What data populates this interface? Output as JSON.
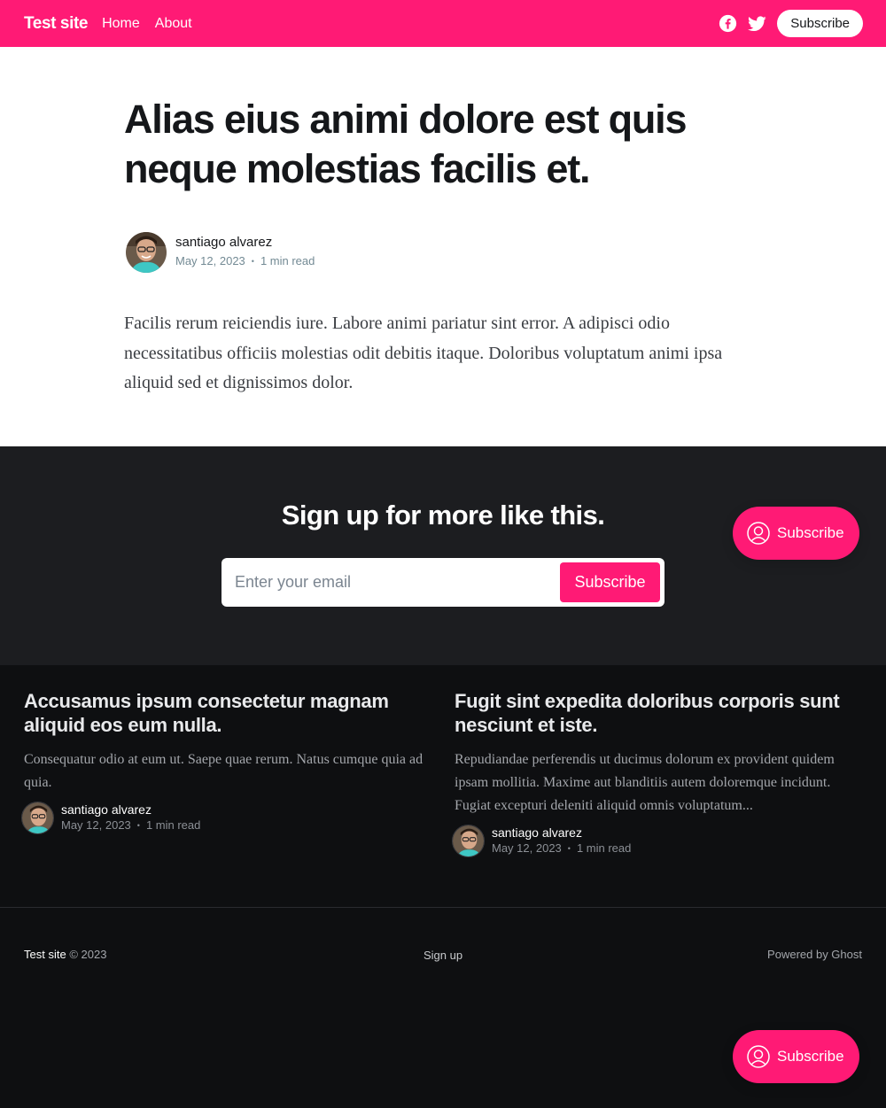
{
  "header": {
    "site_title": "Test site",
    "nav": [
      "Home",
      "About"
    ],
    "social": [
      "facebook-icon",
      "twitter-icon"
    ],
    "subscribe_label": "Subscribe",
    "bg_color": "#ff1a75"
  },
  "article": {
    "title": "Alias eius animi dolore est quis neque molestias facilis et.",
    "author": "santiago alvarez",
    "date": "May 12, 2023",
    "read_time": "1 min read",
    "excerpt": "Facilis rerum reiciendis iure. Labore animi pariatur sint error. A adipisci odio necessitatibus officiis molestias odit debitis itaque. Doloribus voluptatum animi ipsa aliquid sed et dignissimos dolor."
  },
  "cta": {
    "title": "Sign up for more like this.",
    "email_placeholder": "Enter your email",
    "button_label": "Subscribe"
  },
  "portal": {
    "label": "Subscribe",
    "icon": "user-circle-icon"
  },
  "related": [
    {
      "title": "Accusamus ipsum consectetur magnam aliquid eos eum nulla.",
      "excerpt": "Consequatur odio at eum ut. Saepe quae rerum. Natus cumque quia ad quia.",
      "author": "santiago alvarez",
      "date": "May 12, 2023",
      "read_time": "1 min read"
    },
    {
      "title": "Fugit sint expedita doloribus corporis sunt nesciunt et iste.",
      "excerpt": "Repudiandae perferendis ut ducimus dolorum ex provident quidem ipsam mollitia. Maxime aut blanditiis autem doloremque incidunt. Fugiat excepturi deleniti aliquid omnis voluptatum...",
      "author": "santiago alvarez",
      "date": "May 12, 2023",
      "read_time": "1 min read"
    }
  ],
  "footer": {
    "site_title": "Test site",
    "copyright": "© 2023",
    "signup": "Sign up",
    "powered": "Powered by Ghost"
  }
}
